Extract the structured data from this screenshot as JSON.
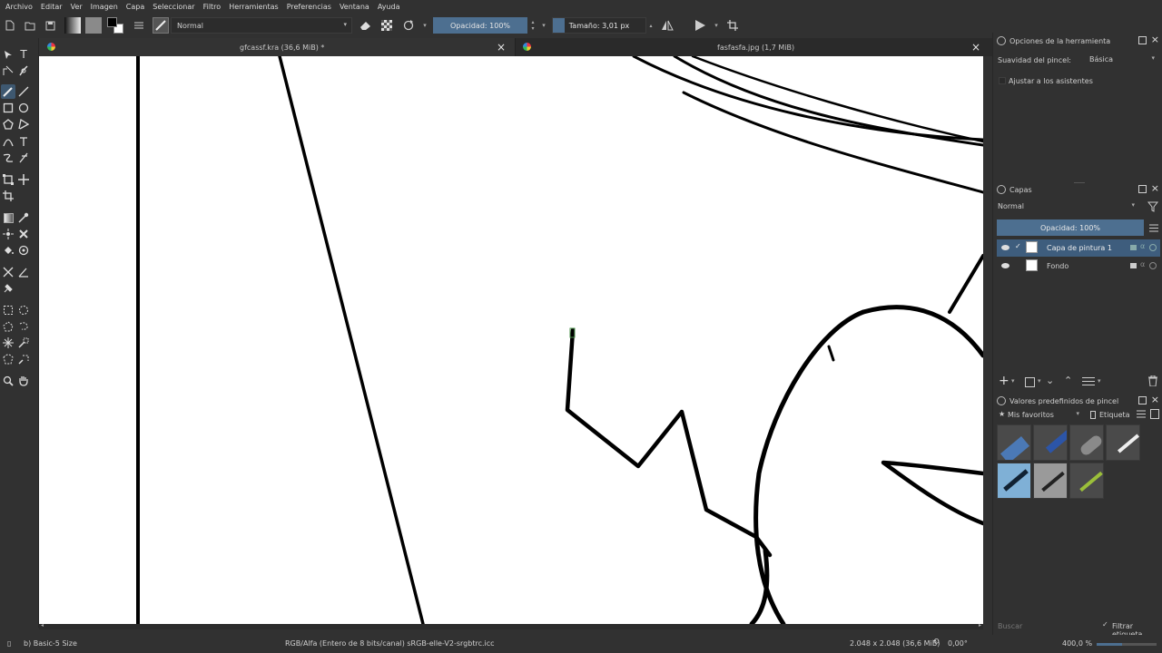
{
  "menu": [
    "Archivo",
    "Editar",
    "Ver",
    "Imagen",
    "Capa",
    "Seleccionar",
    "Filtro",
    "Herramientas",
    "Preferencias",
    "Ventana",
    "Ayuda"
  ],
  "toolbar": {
    "blend_mode": "Normal",
    "opacity_label": "Opacidad: 100%",
    "size_label": "Tamaño: 3,01 px"
  },
  "tabs": [
    {
      "title": "gfcassf.kra (36,6 MiB) *"
    },
    {
      "title": "fasfasfa.jpg (1,7 MiB)"
    }
  ],
  "tool_options": {
    "title": "Opciones de la herramienta",
    "smoothing_label": "Suavidad del pincel:",
    "smoothing_value": "Básica",
    "assistant_label": "Ajustar a los asistentes"
  },
  "layers": {
    "title": "Capas",
    "blend_mode": "Normal",
    "opacity_label": "Opacidad:  100%",
    "items": [
      {
        "name": "Capa de pintura 1",
        "selected": true
      },
      {
        "name": "Fondo",
        "selected": false
      }
    ]
  },
  "brush_presets": {
    "title": "Valores predefinidos de pincel",
    "tag_selector": "Mis favoritos",
    "tag_label": "Etiqueta",
    "search_placeholder": "Buscar",
    "filter_label": "Filtrar etiqueta"
  },
  "status": {
    "brush": "b) Basic-5 Size",
    "color_profile": "RGB/Alfa (Entero de 8 bits/canal)  sRGB-elle-V2-srgbtrc.icc",
    "image_size": "2.048 x 2.048 (36,6 MiB)",
    "rotation": "0,00°",
    "zoom": "400,0 %"
  },
  "colors": {
    "background": "#313131",
    "selection": "#3e5d7d",
    "slider": "#4d6f90",
    "canvas": "#ffffff"
  }
}
